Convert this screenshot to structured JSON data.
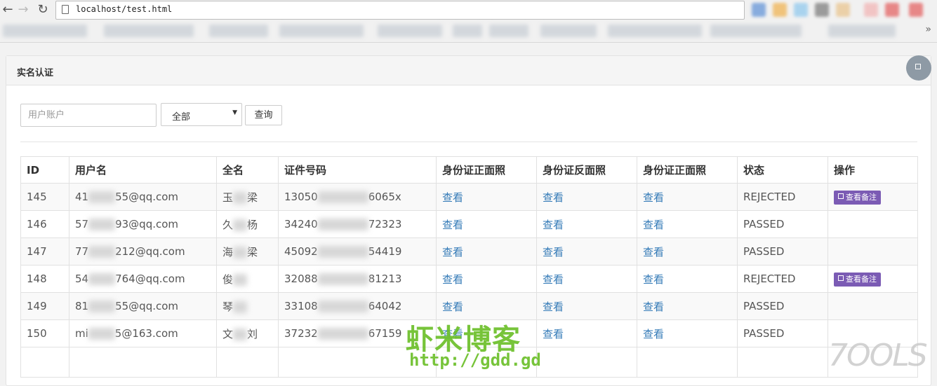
{
  "browser": {
    "url": "localhost/test.html",
    "icons": {
      "back": "back-arrow-icon",
      "forward": "forward-arrow-icon",
      "reload": "reload-icon",
      "page": "page-icon"
    }
  },
  "panel": {
    "title": "实名认证"
  },
  "filter": {
    "account_placeholder": "用户账户",
    "status_selected": "全部",
    "query_label": "查询"
  },
  "table": {
    "headers": [
      "ID",
      "用户名",
      "全名",
      "证件号码",
      "身份证正面照",
      "身份证反面照",
      "身份证正面照",
      "状态",
      "操作"
    ],
    "rows": [
      {
        "id": "145",
        "user_a": "41",
        "user_b": "55@qq.com",
        "name_a": "玉",
        "name_b": "梁",
        "cert_a": "13050",
        "cert_b": "6065x",
        "front": "查看",
        "back": "查看",
        "front2": "查看",
        "status": "REJECTED",
        "action": "查看备注"
      },
      {
        "id": "146",
        "user_a": "57",
        "user_b": "93@qq.com",
        "name_a": "久",
        "name_b": "杨",
        "cert_a": "34240",
        "cert_b": "72323",
        "front": "查看",
        "back": "查看",
        "front2": "查看",
        "status": "PASSED",
        "action": ""
      },
      {
        "id": "147",
        "user_a": "77",
        "user_b": "212@qq.com",
        "name_a": "海",
        "name_b": "梁",
        "cert_a": "45092",
        "cert_b": "54419",
        "front": "查看",
        "back": "查看",
        "front2": "查看",
        "status": "PASSED",
        "action": ""
      },
      {
        "id": "148",
        "user_a": "54",
        "user_b": "764@qq.com",
        "name_a": "俊",
        "name_b": "",
        "cert_a": "32088",
        "cert_b": "81213",
        "front": "查看",
        "back": "查看",
        "front2": "查看",
        "status": "REJECTED",
        "action": "查看备注"
      },
      {
        "id": "149",
        "user_a": "81",
        "user_b": "55@qq.com",
        "name_a": "琴",
        "name_b": "",
        "cert_a": "33108",
        "cert_b": "64042",
        "front": "查看",
        "back": "查看",
        "front2": "查看",
        "status": "PASSED",
        "action": ""
      },
      {
        "id": "150",
        "user_a": "mi",
        "user_b": "5@163.com",
        "name_a": "文",
        "name_b": "刘",
        "cert_a": "37232",
        "cert_b": "67159",
        "front": "查看",
        "back": "查看",
        "front2": "查看",
        "status": "PASSED",
        "action": ""
      }
    ]
  },
  "watermark": {
    "site_name": "虾米博客",
    "site_url": "http://gdd.gd",
    "tools_logo": "7OOLS"
  },
  "colors": {
    "link": "#337ab7",
    "note_button": "#7b5bb4",
    "watermark": "#6cbf2a"
  }
}
